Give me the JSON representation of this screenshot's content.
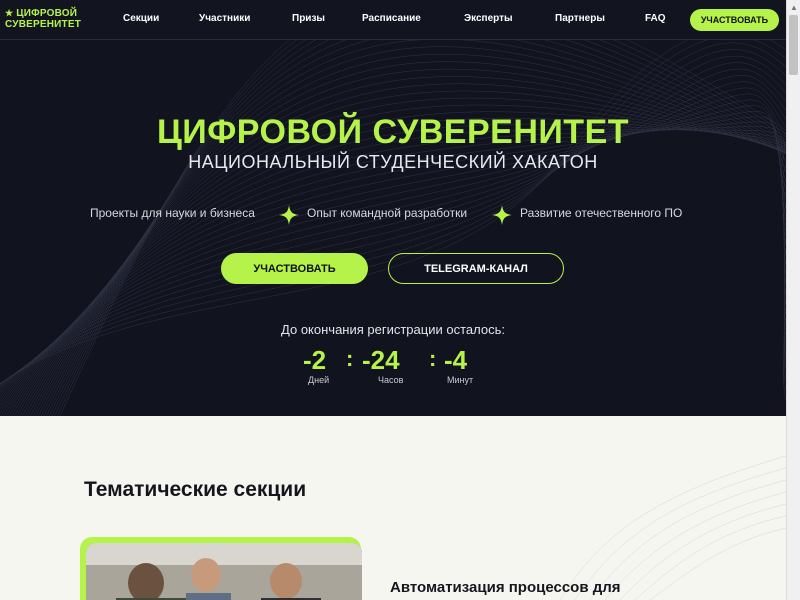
{
  "header": {
    "logo_star": "★",
    "logo_line1": "ЦИФРОВОЙ",
    "logo_line2": "СУВЕРЕНИТЕТ",
    "nav": [
      "Секции",
      "Участники",
      "Призы",
      "Расписание",
      "Эксперты",
      "Партнеры",
      "FAQ"
    ],
    "cta": "УЧАСТВОВАТЬ"
  },
  "hero": {
    "title": "ЦИФРОВОЙ СУВЕРЕНИТЕТ",
    "subtitle": "НАЦИОНАЛЬНЫЙ СТУДЕНЧЕСКИЙ ХАКАТОН",
    "features": [
      "Проекты для науки и бизнеса",
      "Опыт командной разработки",
      "Развитие отечественного ПО"
    ],
    "primary_button": "УЧАСТВОВАТЬ",
    "secondary_button": "TELEGRAM-КАНАЛ",
    "countdown_label": "До окончания регистрации осталось:",
    "countdown": {
      "days": "-2",
      "days_label": "Дней",
      "hours": "-24",
      "hours_label": "Часов",
      "minutes": "-4",
      "minutes_label": "Минут",
      "separator": ":"
    }
  },
  "sections": {
    "title": "Тематические секции",
    "card_heading": "Автоматизация процессов для"
  },
  "colors": {
    "accent": "#b6f34a",
    "dark_bg": "#11131f",
    "light_bg": "#f6f6f1"
  }
}
